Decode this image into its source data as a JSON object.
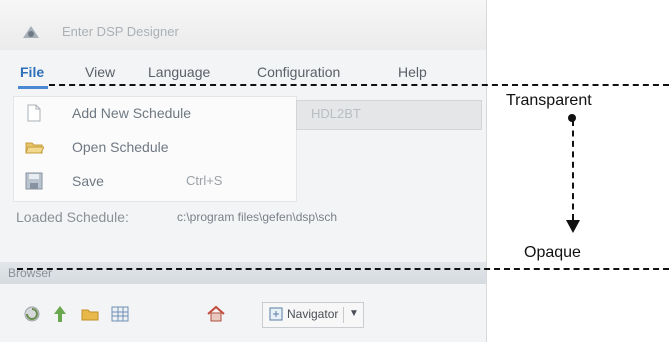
{
  "app": {
    "title": "Enter DSP Designer",
    "menu": [
      "File",
      "View",
      "Language",
      "Configuration",
      "Help"
    ],
    "active_menu": "File",
    "file_menu_items": [
      {
        "label": "Add New Schedule",
        "shortcut": ""
      },
      {
        "label": "Open Schedule",
        "shortcut": ""
      },
      {
        "label": "Save",
        "shortcut": "Ctrl+S"
      }
    ],
    "faded_field_text": "HDL2BT",
    "loaded_schedule_label": "Loaded Schedule:",
    "loaded_schedule_path": "c:\\program files\\gefen\\dsp\\sch",
    "browser_label": "Browser",
    "toolbar": {
      "navigator_label": "Navigator"
    }
  },
  "annotations": {
    "top_label": "Transparent",
    "bottom_label": "Opaque"
  },
  "icons": [
    "app-logo-icon",
    "new-file-icon",
    "open-folder-icon",
    "save-disk-icon",
    "refresh-icon",
    "up-arrow-icon",
    "folder-icon",
    "grid-view-icon",
    "home-icon",
    "navigator-icon",
    "chevron-down-icon"
  ]
}
